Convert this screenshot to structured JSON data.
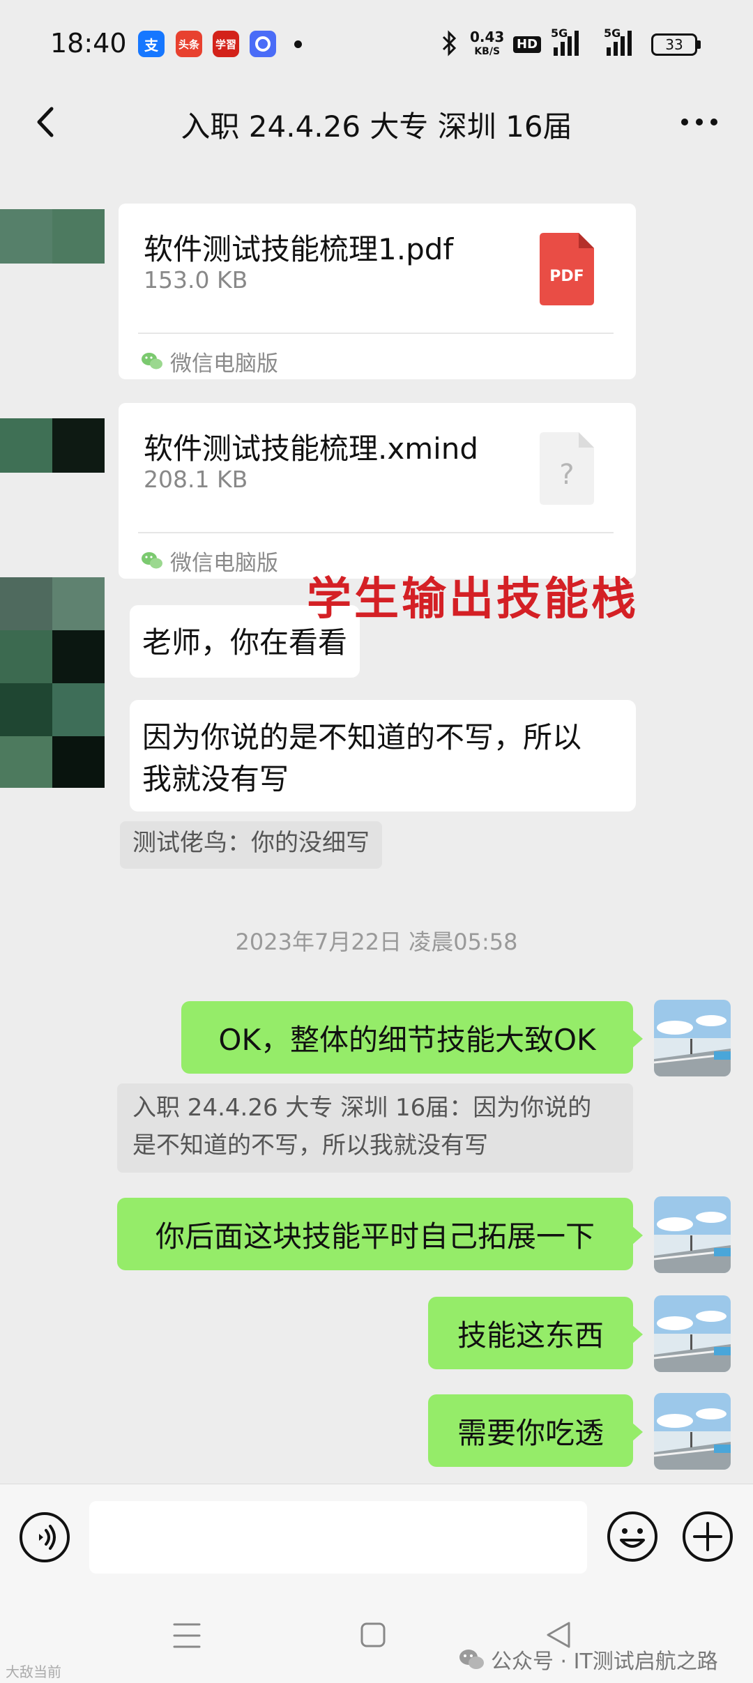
{
  "status_bar": {
    "time": "18:40",
    "app_icons": [
      {
        "name": "alipay",
        "label": "支",
        "color": "#1677ff"
      },
      {
        "name": "toutiao",
        "label": "头条",
        "color": "#e8412f"
      },
      {
        "name": "xuexi",
        "label": "学習",
        "color": "#d3221a"
      },
      {
        "name": "browser",
        "label": "",
        "color": "#4a6cf7"
      }
    ],
    "net_speed": "0.43",
    "net_unit": "KB/S",
    "hd_label": "HD",
    "sim1": "5G",
    "sim2": "5G",
    "battery": "33"
  },
  "header": {
    "title": "入职 24.4.26 大专 深圳 16届"
  },
  "messages": {
    "file1": {
      "name": "软件测试技能梳理1.pdf",
      "size": "153.0 KB",
      "source": "微信电脑版",
      "icon_label": "PDF"
    },
    "file2": {
      "name": "软件测试技能梳理.xmind",
      "size": "208.1 KB",
      "source": "微信电脑版",
      "icon_label": "?"
    },
    "text1": "老师，你在看看",
    "text2_line1": "因为你说的是不知道的不写，所以",
    "text2_line2": "我就没有写",
    "quote1": "测试佬鸟：你的没细写",
    "timestamp": "2023年7月22日 凌晨05:58",
    "reply1": "OK，整体的细节技能大致OK",
    "quote2_line1": "入职 24.4.26 大专 深圳 16届：因为你说的",
    "quote2_line2": "是不知道的不写，所以我就没有写",
    "reply2": "你后面这块技能平时自己拓展一下",
    "reply3": "技能这东西",
    "reply4": "需要你吃透"
  },
  "overlay_text": "学生输出技能栈",
  "colors": {
    "bubble_green": "#95ec69",
    "chat_bg": "#ededed",
    "pdf_red": "#e94d45",
    "watermark_red": "#d42025"
  },
  "footer": {
    "credit": "公众号 · IT测试启航之路",
    "corner_mark": "大敌当前"
  },
  "icons": [
    "back-arrow-icon",
    "more-icon",
    "voice-icon",
    "emoji-icon",
    "plus-icon",
    "menu-icon",
    "home-icon",
    "back-triangle-icon",
    "wechat-icon",
    "pdf-icon",
    "unknown-file-icon"
  ]
}
